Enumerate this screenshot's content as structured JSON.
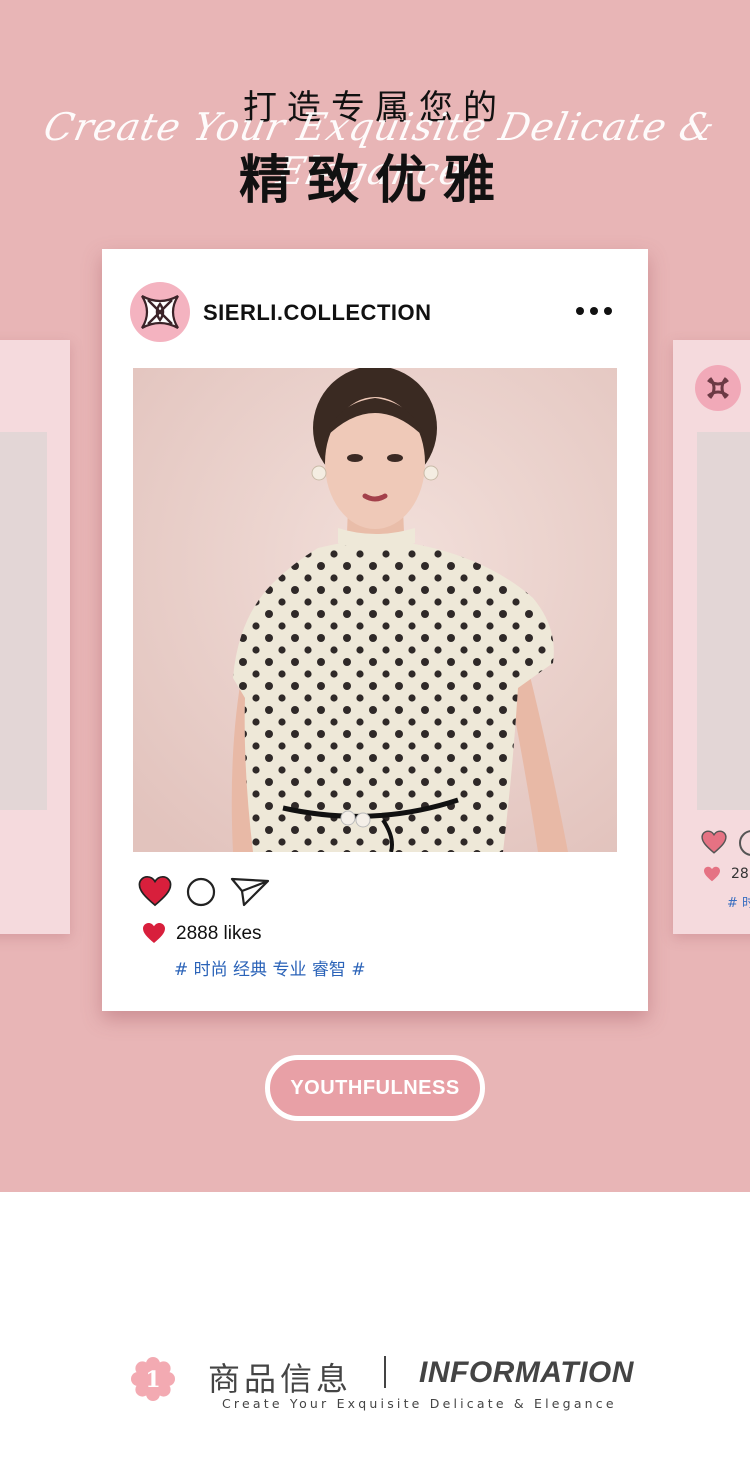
{
  "header": {
    "title_line1": "打造专属您的",
    "script_text": "Create Your Exquisite Delicate & Elegance",
    "title_line2": "精致优雅"
  },
  "post": {
    "brand_name": "SIERLI.COLLECTION",
    "more_icon": "more-dots-icon",
    "likes_text": "2888 likes",
    "hashtags": "# 时尚 经典 专业 睿智 #",
    "actions": [
      "heart-icon",
      "comment-icon",
      "share-icon"
    ]
  },
  "side_preview": {
    "likes_text": "28",
    "hashtags": "# 时"
  },
  "category_button": {
    "label": "YOUTHFULNESS"
  },
  "info_section": {
    "number": "1",
    "title_cn": "商品信息",
    "title_en": "INFORMATION",
    "subtitle": "Create Your Exquisite Delicate & Elegance"
  },
  "colors": {
    "hero_background": "#e8b5b6",
    "heart_red": "#d81f3c",
    "hashtag_blue": "#2b63b8",
    "pill_fill": "#e8a0a6"
  }
}
